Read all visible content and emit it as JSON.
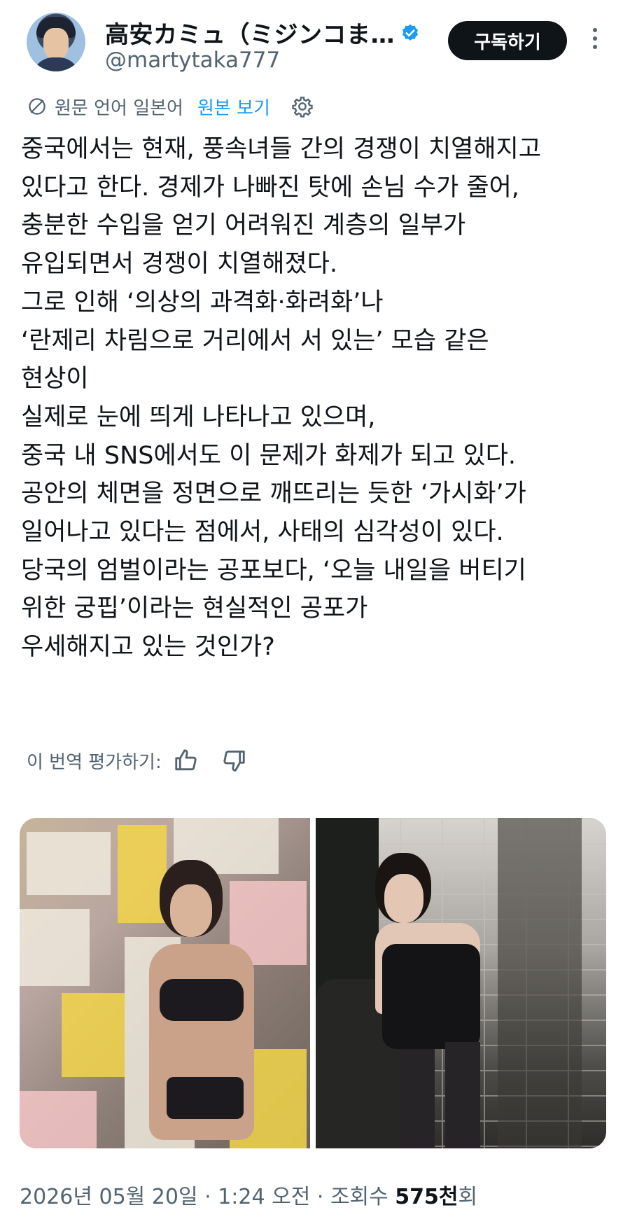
{
  "header": {
    "display_name": "高安カミュ（ミジンコま…",
    "handle": "@martytaka777",
    "subscribe_label": "구독하기"
  },
  "translation": {
    "label": "원문 언어 일본어",
    "view_original": "원본 보기"
  },
  "tweet": {
    "lines": [
      "중국에서는 현재, 풍속녀들 간의 경쟁이 치열해지고",
      "있다고 한다. 경제가 나빠진 탓에 손님 수가 줄어,",
      "충분한 수입을 얻기 어려워진 계층의 일부가",
      "유입되면서 경쟁이 치열해졌다.",
      "그로 인해 ‘의상의 과격화·화려화’나",
      "‘란제리 차림으로 거리에서 서 있는’ 모습 같은",
      "현상이",
      "실제로 눈에 띄게 나타나고 있으며,",
      "중국 내 SNS에서도 이 문제가 화제가 되고 있다.",
      "공안의 체면을 정면으로 깨뜨리는 듯한 ‘가시화’가",
      "일어나고 있다는 점에서, 사태의 심각성이 있다.",
      "당국의 엄벌이라는 공포보다, ‘오늘 내일을 버티기",
      "위한 궁핍’이라는 현실적인 공포가",
      "우세해지고 있는 것인가?"
    ]
  },
  "rating": {
    "label": "이 번역 평가하기:"
  },
  "meta": {
    "date": "2026년 05월 20일",
    "time": "1:24 오전",
    "views_prefix": "조회수",
    "views_count": "575천",
    "views_suffix": "회"
  },
  "colors": {
    "accent": "#1d9bf0",
    "text": "#0f1419",
    "muted": "#536471"
  }
}
